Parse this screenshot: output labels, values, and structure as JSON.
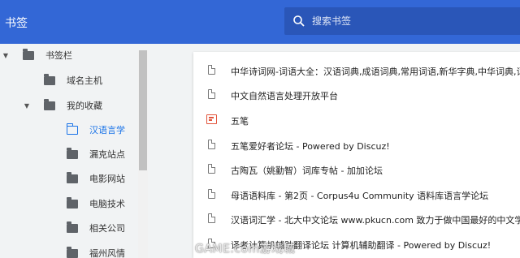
{
  "header": {
    "title": "书签"
  },
  "search": {
    "placeholder": "搜索书签"
  },
  "sidebar": {
    "items": [
      {
        "label": "书签栏",
        "arrow": "▼",
        "icon": "folder-icon",
        "expanded": true
      },
      {
        "label": "域名主机",
        "arrow": "",
        "icon": "folder-icon"
      },
      {
        "label": "我的收藏",
        "arrow": "▼",
        "icon": "folder-icon",
        "expanded": true
      },
      {
        "label": "汉语言学",
        "arrow": "",
        "icon": "folder-open-icon",
        "active": true
      },
      {
        "label": "漏克站点",
        "arrow": "",
        "icon": "folder-icon"
      },
      {
        "label": "电影网站",
        "arrow": "",
        "icon": "folder-icon"
      },
      {
        "label": "电脑技术",
        "arrow": "",
        "icon": "folder-icon"
      },
      {
        "label": "相关公司",
        "arrow": "",
        "icon": "folder-icon"
      },
      {
        "label": "福州风情",
        "arrow": "",
        "icon": "folder-icon"
      }
    ]
  },
  "bookmarks": [
    {
      "title": "中华诗词网-词语大全：汉语词典,成语词典,常用词语,新华字典,中华词典,词语查询,",
      "icon": "page-icon"
    },
    {
      "title": "中文自然语言处理开放平台",
      "icon": "page-icon"
    },
    {
      "title": "五笔",
      "icon": "wubi-favicon"
    },
    {
      "title": "五笔爱好者论坛 - Powered by Discuz!",
      "icon": "page-icon"
    },
    {
      "title": "古陶瓦（姚勤智）词库专帖 - 加加论坛",
      "icon": "page-icon"
    },
    {
      "title": "母语语料库 - 第2页 - Corpus4u Community 语料库语言学论坛",
      "icon": "page-icon"
    },
    {
      "title": "汉语词汇学 - 北大中文论坛 www.pkucn.com 致力于做中国最好的中文学术论坛！",
      "icon": "page-icon"
    },
    {
      "title": "译者计算机辅助翻译论坛 计算机辅助翻译 - Powered by Discuz!",
      "icon": "page-icon"
    }
  ],
  "watermark": "GAME.com游戏城",
  "colors": {
    "header": "#3367d6",
    "search_bg": "#2a56b8",
    "active": "#1a73e8",
    "background": "#f1f3f4"
  }
}
